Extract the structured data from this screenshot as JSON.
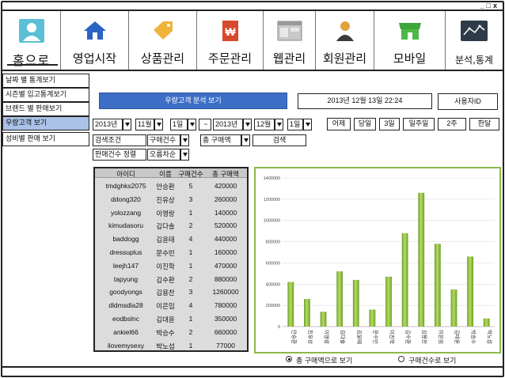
{
  "window": {
    "controls": "_□x"
  },
  "nav": [
    {
      "label": "홈으로",
      "icon": "person-icon"
    },
    {
      "label": "영업시작",
      "icon": "house-icon"
    },
    {
      "label": "상품관리",
      "icon": "tag-icon"
    },
    {
      "label": "주문관리",
      "icon": "invoice-icon"
    },
    {
      "label": "웹관리",
      "icon": "browser-icon"
    },
    {
      "label": "회원관리",
      "icon": "member-icon"
    },
    {
      "label": "모바일",
      "icon": "store-icon"
    },
    {
      "label": "분석,통계",
      "icon": "chart-icon"
    }
  ],
  "sidebar": [
    {
      "label": "날짜 별 통계보기"
    },
    {
      "label": "시즌별 입고통계보기"
    },
    {
      "label": "브랜드 별 판매보기"
    },
    {
      "label": "우량고객 보기"
    },
    {
      "label": "성비별 판매 보기"
    }
  ],
  "toolbar": {
    "main_button": "우량고객 분석 보기",
    "datetime": "2013년 12월 13일 22:24",
    "user": "사용자ID"
  },
  "date_range": {
    "from_year": "2013년",
    "from_month": "11월",
    "from_day": "1일",
    "tilde": "~",
    "to_year": "2013년",
    "to_month": "12월",
    "to_day": "1일"
  },
  "quick_ranges": [
    "어제",
    "당일",
    "3일",
    "일주일",
    "2주",
    "한달"
  ],
  "filters": {
    "label": "검색조건",
    "field": "구매건수",
    "field2": "총 구매액",
    "search": "검색",
    "sort_label": "판매건수 정렬",
    "sort": "오름차순"
  },
  "table": {
    "headers": [
      "아이디",
      "이름",
      "구매건수",
      "총 구매액"
    ],
    "rows": [
      [
        "tmdghks2075",
        "안승환",
        "5",
        "420000"
      ],
      [
        "ddong320",
        "진유상",
        "3",
        "260000"
      ],
      [
        "yolozzang",
        "이영랑",
        "1",
        "140000"
      ],
      [
        "kimudasoru",
        "김다솔",
        "2",
        "520000"
      ],
      [
        "baddogg",
        "김윤태",
        "4",
        "440000"
      ],
      [
        "dressuplus",
        "문수빈",
        "1",
        "160000"
      ],
      [
        "leejh147",
        "이진학",
        "1",
        "470000"
      ],
      [
        "tapyung",
        "김수환",
        "2",
        "880000"
      ],
      [
        "goodyongs",
        "김용찬",
        "3",
        "1260000"
      ],
      [
        "dldmsdla28",
        "이은임",
        "4",
        "780000"
      ],
      [
        "eodbslnc",
        "김대윤",
        "1",
        "350000"
      ],
      [
        "ankiel66",
        "박승수",
        "2",
        "660000"
      ],
      [
        "ilovemysexy",
        "박노섭",
        "1",
        "77000"
      ]
    ]
  },
  "chart_data": {
    "type": "bar",
    "categories": [
      "안승환",
      "진유상",
      "이영랑",
      "김다솔",
      "김윤태",
      "문수빈",
      "이진학",
      "김수환",
      "김용찬",
      "이은임",
      "김대윤",
      "박승수",
      "박노섭"
    ],
    "values": [
      420000,
      260000,
      140000,
      520000,
      440000,
      160000,
      470000,
      880000,
      1260000,
      780000,
      350000,
      660000,
      77000
    ],
    "ylim": [
      0,
      1400000
    ],
    "yticks": [
      0,
      200000,
      400000,
      600000,
      800000,
      1000000,
      1200000,
      1400000
    ],
    "grid": true,
    "bar_color": "#8fbf3e"
  },
  "radios": {
    "option1": "총 구매액으로 보기",
    "option2": "구매건수로 보기",
    "selected": "option1"
  }
}
